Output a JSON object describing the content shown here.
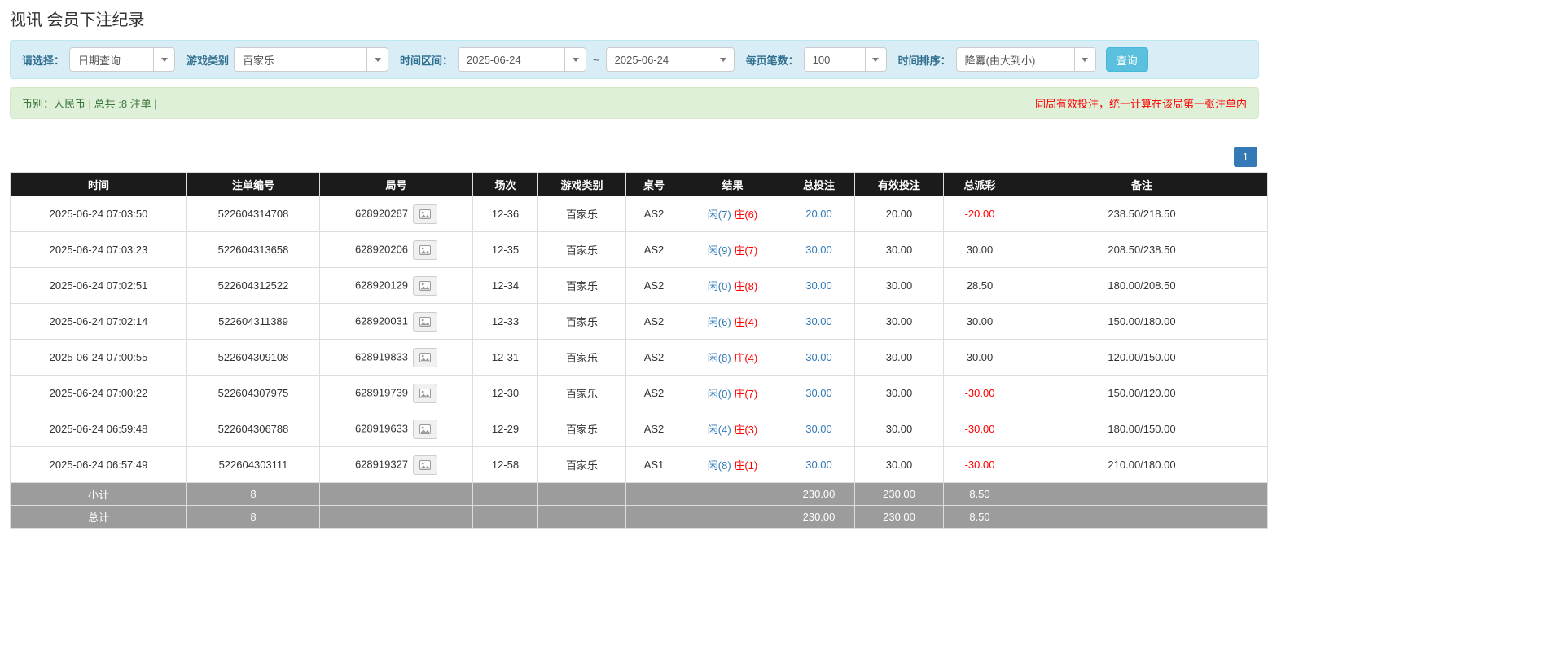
{
  "page": {
    "title": "视讯 会员下注纪录"
  },
  "filters": {
    "select_label": "请选择：",
    "select_value": "日期查询",
    "game_type_label": "游戏类别",
    "game_type_value": "百家乐",
    "time_range_label": "时间区间：",
    "date_from": "2025-06-24",
    "tilde": "~",
    "date_to": "2025-06-24",
    "page_size_label": "每页笔数：",
    "page_size_value": "100",
    "sort_label": "时间排序：",
    "sort_value": "降冪(由大到小)",
    "search_button": "查询"
  },
  "summary": {
    "left": "币别：人民币 | 总共 :8 注单 |",
    "right": "同局有效投注，统一计算在该局第一张注单内"
  },
  "pagination": {
    "current": "1"
  },
  "table": {
    "headers": [
      "时间",
      "注单编号",
      "局号",
      "场次",
      "游戏类别",
      "桌号",
      "结果",
      "总投注",
      "有效投注",
      "总派彩",
      "备注"
    ],
    "rows": [
      {
        "time": "2025-06-24 07:03:50",
        "bet_id": "522604314708",
        "round_id": "628920287",
        "session": "12-36",
        "game": "百家乐",
        "table_no": "AS2",
        "result_player": "闲(7)",
        "result_banker": "庄(6)",
        "total_bet": "20.00",
        "valid_bet": "20.00",
        "payout": "-20.00",
        "remark": "238.50/218.50"
      },
      {
        "time": "2025-06-24 07:03:23",
        "bet_id": "522604313658",
        "round_id": "628920206",
        "session": "12-35",
        "game": "百家乐",
        "table_no": "AS2",
        "result_player": "闲(9)",
        "result_banker": "庄(7)",
        "total_bet": "30.00",
        "valid_bet": "30.00",
        "payout": "30.00",
        "remark": "208.50/238.50"
      },
      {
        "time": "2025-06-24 07:02:51",
        "bet_id": "522604312522",
        "round_id": "628920129",
        "session": "12-34",
        "game": "百家乐",
        "table_no": "AS2",
        "result_player": "闲(0)",
        "result_banker": "庄(8)",
        "total_bet": "30.00",
        "valid_bet": "30.00",
        "payout": "28.50",
        "remark": "180.00/208.50"
      },
      {
        "time": "2025-06-24 07:02:14",
        "bet_id": "522604311389",
        "round_id": "628920031",
        "session": "12-33",
        "game": "百家乐",
        "table_no": "AS2",
        "result_player": "闲(6)",
        "result_banker": "庄(4)",
        "total_bet": "30.00",
        "valid_bet": "30.00",
        "payout": "30.00",
        "remark": "150.00/180.00"
      },
      {
        "time": "2025-06-24 07:00:55",
        "bet_id": "522604309108",
        "round_id": "628919833",
        "session": "12-31",
        "game": "百家乐",
        "table_no": "AS2",
        "result_player": "闲(8)",
        "result_banker": "庄(4)",
        "total_bet": "30.00",
        "valid_bet": "30.00",
        "payout": "30.00",
        "remark": "120.00/150.00"
      },
      {
        "time": "2025-06-24 07:00:22",
        "bet_id": "522604307975",
        "round_id": "628919739",
        "session": "12-30",
        "game": "百家乐",
        "table_no": "AS2",
        "result_player": "闲(0)",
        "result_banker": "庄(7)",
        "total_bet": "30.00",
        "valid_bet": "30.00",
        "payout": "-30.00",
        "remark": "150.00/120.00"
      },
      {
        "time": "2025-06-24 06:59:48",
        "bet_id": "522604306788",
        "round_id": "628919633",
        "session": "12-29",
        "game": "百家乐",
        "table_no": "AS2",
        "result_player": "闲(4)",
        "result_banker": "庄(3)",
        "total_bet": "30.00",
        "valid_bet": "30.00",
        "payout": "-30.00",
        "remark": "180.00/150.00"
      },
      {
        "time": "2025-06-24 06:57:49",
        "bet_id": "522604303111",
        "round_id": "628919327",
        "session": "12-58",
        "game": "百家乐",
        "table_no": "AS1",
        "result_player": "闲(8)",
        "result_banker": "庄(1)",
        "total_bet": "30.00",
        "valid_bet": "30.00",
        "payout": "-30.00",
        "remark": "210.00/180.00"
      }
    ],
    "subtotal": {
      "label": "小计",
      "count": "8",
      "total_bet": "230.00",
      "valid_bet": "230.00",
      "payout": "8.50"
    },
    "total": {
      "label": "总计",
      "count": "8",
      "total_bet": "230.00",
      "valid_bet": "230.00",
      "payout": "8.50"
    }
  }
}
